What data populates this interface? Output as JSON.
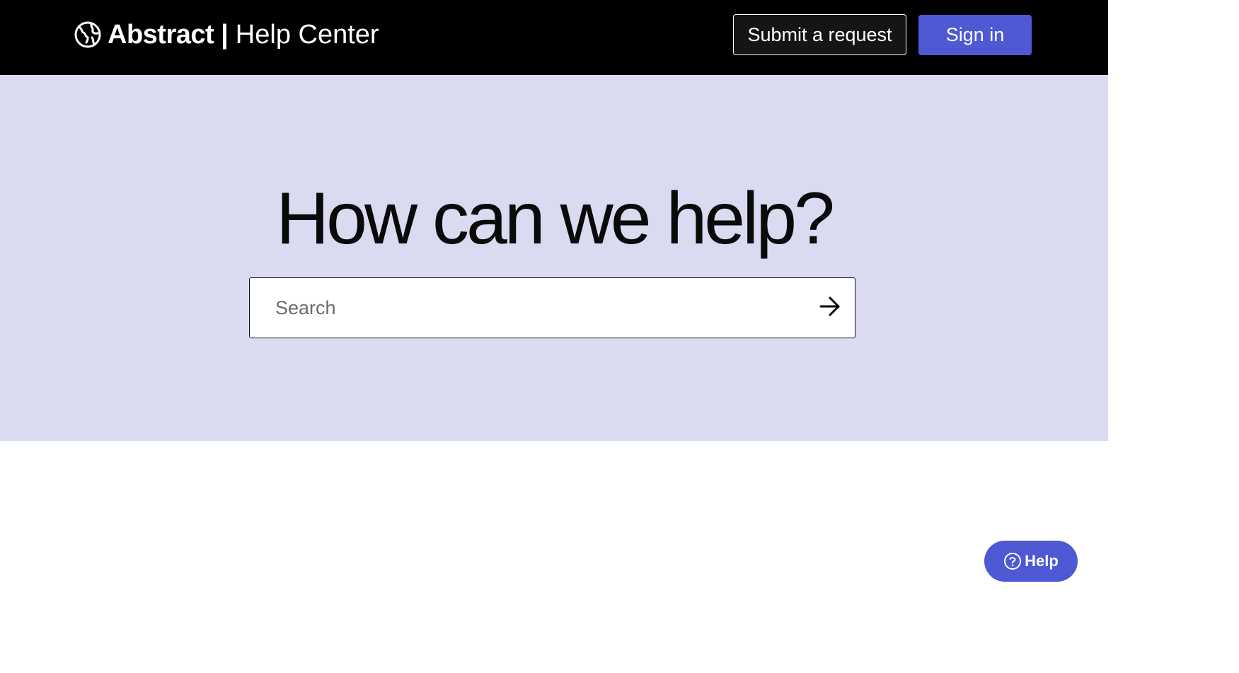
{
  "header": {
    "brand_name": "Abstract",
    "brand_separator": "|",
    "brand_subtitle": "Help Center",
    "logo_icon": "globe-icon",
    "submit_request_label": "Submit a request",
    "sign_in_label": "Sign in"
  },
  "hero": {
    "title": "How can we help?",
    "search_placeholder": "Search",
    "search_value": "",
    "search_submit_icon": "arrow-right-icon"
  },
  "help_widget": {
    "label": "Help",
    "icon": "question-circle-icon"
  },
  "colors": {
    "header_bg": "#000000",
    "hero_bg": "#dadbf0",
    "accent": "#4f59d3",
    "text_dark": "#0a0a0a"
  }
}
